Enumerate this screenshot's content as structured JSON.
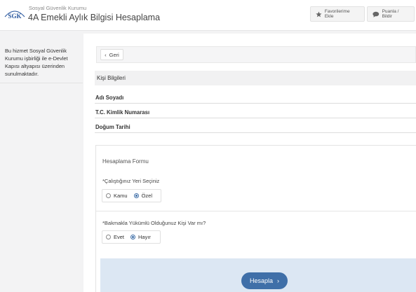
{
  "header": {
    "logo_text": "SGK",
    "org_name": "Sosyal Güvenlik Kurumu",
    "page_title": "4A Emekli Aylık Bilgisi Hesaplama",
    "favorite_label": "Favorilerime Ekle",
    "rate_label": "Puanla / Bildir"
  },
  "sidebar": {
    "notice": "Bu hizmet Sosyal Güvenlik Kurumu işbirliği ile e-Devlet Kapısı altyapısı üzerinden sunulmaktadır."
  },
  "back_button": {
    "label": "Geri"
  },
  "personal_info": {
    "title": "Kişi Bilgileri",
    "fields": [
      "Adı Soyadı",
      "T.C. Kimlik Numarası",
      "Doğum Tarihi"
    ]
  },
  "form": {
    "title": "Hesaplama Formu",
    "q1": {
      "label": "*Çalıştığınız Yeri Seçiniz",
      "options": [
        "Kamu",
        "Özel"
      ],
      "selected": "Özel"
    },
    "q2": {
      "label": "*Bakmakla Yükümlü Olduğunuz Kişi Var mı?",
      "options": [
        "Evet",
        "Hayır"
      ],
      "selected": "Hayır"
    },
    "submit_label": "Hesapla"
  },
  "colors": {
    "accent": "#3f6fa8",
    "calc_bar": "#dce7f3"
  }
}
